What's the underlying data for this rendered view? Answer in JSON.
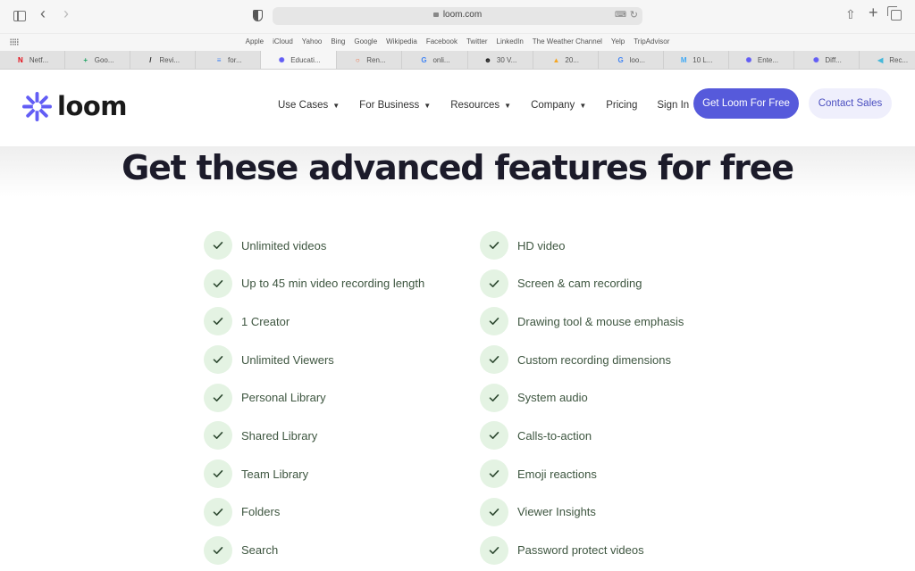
{
  "browser": {
    "url": "loom.com",
    "favorites": [
      "Apple",
      "iCloud",
      "Yahoo",
      "Bing",
      "Google",
      "Wikipedia",
      "Facebook",
      "Twitter",
      "LinkedIn",
      "The Weather Channel",
      "Yelp",
      "TripAdvisor"
    ],
    "tabs": [
      {
        "label": "Netf...",
        "icon": "netflix-icon",
        "icon_glyph": "N",
        "icon_color": "#e50914",
        "active": false
      },
      {
        "label": "Goo...",
        "icon": "google-sheets-plus-icon",
        "icon_glyph": "+",
        "icon_color": "#1fa463",
        "active": false
      },
      {
        "label": "Revi...",
        "icon": "revision-icon",
        "icon_glyph": "/",
        "icon_color": "#1a1a1a",
        "active": false
      },
      {
        "label": "for...",
        "icon": "google-docs-icon",
        "icon_glyph": "≡",
        "icon_color": "#4285f4",
        "active": false
      },
      {
        "label": "Educati...",
        "icon": "loom-icon",
        "icon_glyph": "✺",
        "icon_color": "#625df5",
        "active": true
      },
      {
        "label": "Ren...",
        "icon": "ring-icon",
        "icon_glyph": "○",
        "icon_color": "#f26b3a",
        "active": false
      },
      {
        "label": "onli...",
        "icon": "google-icon",
        "icon_glyph": "G",
        "icon_color": "#4285f4",
        "active": false
      },
      {
        "label": "30 V...",
        "icon": "user-icon",
        "icon_glyph": "☻",
        "icon_color": "#222222",
        "active": false
      },
      {
        "label": "20...",
        "icon": "mountain-icon",
        "icon_glyph": "▲",
        "icon_color": "#f5a623",
        "active": false
      },
      {
        "label": "loo...",
        "icon": "google-icon",
        "icon_glyph": "G",
        "icon_color": "#4285f4",
        "active": false
      },
      {
        "label": "10 L...",
        "icon": "m-icon",
        "icon_glyph": "M",
        "icon_color": "#3fa9f5",
        "active": false
      },
      {
        "label": "Ente...",
        "icon": "loom-icon",
        "icon_glyph": "✺",
        "icon_color": "#625df5",
        "active": false
      },
      {
        "label": "Diff...",
        "icon": "loom-icon",
        "icon_glyph": "✺",
        "icon_color": "#625df5",
        "active": false
      },
      {
        "label": "Rec...",
        "icon": "arrow-circle-icon",
        "icon_glyph": "◀",
        "icon_color": "#46b8d9",
        "active": false
      }
    ]
  },
  "site": {
    "brand": "loom",
    "brand_color": "#625df5",
    "nav": [
      {
        "label": "Use Cases",
        "dropdown": true
      },
      {
        "label": "For Business",
        "dropdown": true
      },
      {
        "label": "Resources",
        "dropdown": true
      },
      {
        "label": "Company",
        "dropdown": true
      },
      {
        "label": "Pricing",
        "dropdown": false
      },
      {
        "label": "Sign In",
        "dropdown": false
      }
    ],
    "caret": "▼",
    "primary_cta": "Get Loom For Free",
    "secondary_cta": "Contact Sales"
  },
  "hero": {
    "title": "Get these advanced features for free"
  },
  "features": {
    "left": [
      "Unlimited videos",
      "Up to 45 min video recording length",
      "1 Creator",
      "Unlimited Viewers",
      "Personal Library",
      "Shared Library",
      "Team Library",
      "Folders",
      "Search"
    ],
    "right": [
      "HD video",
      "Screen & cam recording",
      "Drawing tool & mouse emphasis",
      "Custom recording dimensions",
      "System audio",
      "Calls-to-action",
      "Emoji reactions",
      "Viewer Insights",
      "Password protect videos"
    ]
  }
}
